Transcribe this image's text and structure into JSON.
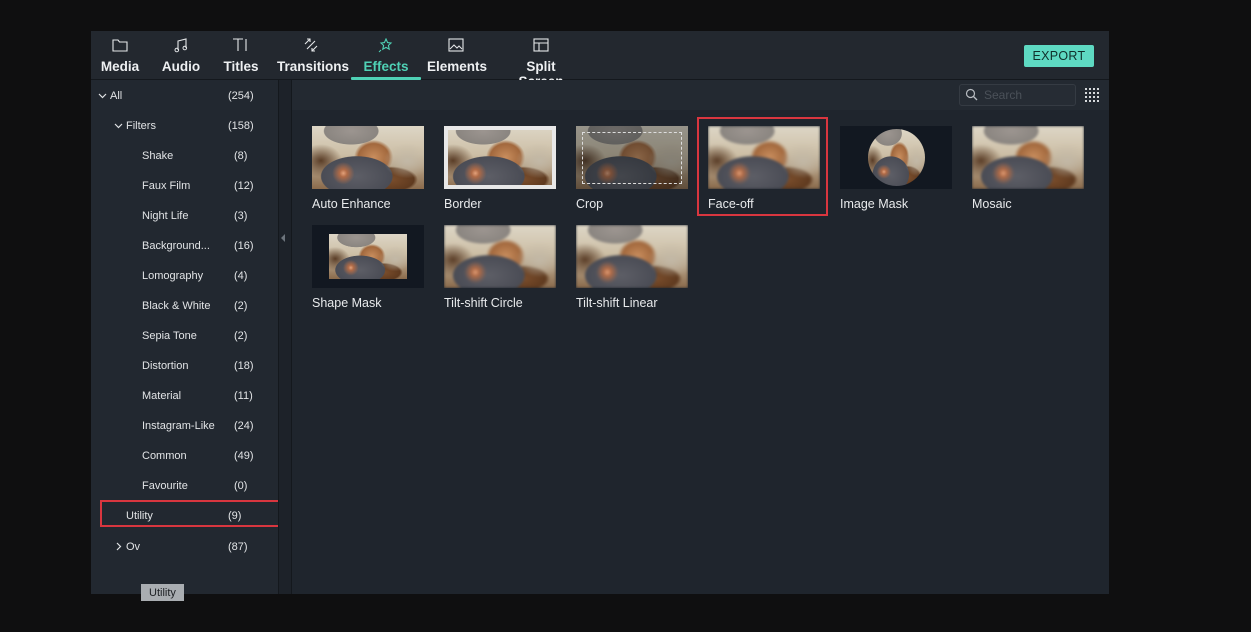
{
  "toolbar": {
    "tabs": [
      {
        "label": "Media",
        "icon": "folder-icon"
      },
      {
        "label": "Audio",
        "icon": "music-note-icon"
      },
      {
        "label": "Titles",
        "icon": "text-cursor-icon"
      },
      {
        "label": "Transitions",
        "icon": "transition-arrows-icon"
      },
      {
        "label": "Effects",
        "icon": "sparkle-icon",
        "active": true
      },
      {
        "label": "Elements",
        "icon": "image-icon"
      },
      {
        "label": "Split Screen",
        "icon": "layout-icon"
      }
    ],
    "export_label": "EXPORT"
  },
  "sidebar": {
    "items": [
      {
        "label": "All",
        "count": "(254)",
        "expanded": true,
        "level": 0
      },
      {
        "label": "Filters",
        "count": "(158)",
        "expanded": true,
        "level": 1
      },
      {
        "label": "Shake",
        "count": "(8)",
        "level": 2
      },
      {
        "label": "Faux Film",
        "count": "(12)",
        "level": 2
      },
      {
        "label": "Night Life",
        "count": "(3)",
        "level": 2
      },
      {
        "label": "Background...",
        "count": "(16)",
        "level": 2
      },
      {
        "label": "Lomography",
        "count": "(4)",
        "level": 2
      },
      {
        "label": "Black & White",
        "count": "(2)",
        "level": 2
      },
      {
        "label": "Sepia Tone",
        "count": "(2)",
        "level": 2
      },
      {
        "label": "Distortion",
        "count": "(18)",
        "level": 2
      },
      {
        "label": "Material",
        "count": "(11)",
        "level": 2
      },
      {
        "label": "Instagram-Like",
        "count": "(24)",
        "level": 2
      },
      {
        "label": "Common",
        "count": "(49)",
        "level": 2
      },
      {
        "label": "Favourite",
        "count": "(0)",
        "level": 2
      },
      {
        "label": "Utility",
        "count": "(9)",
        "level": 1,
        "highlighted": true
      },
      {
        "label": "Ov",
        "count": "(87)",
        "level": 1,
        "collapsed": true
      }
    ],
    "tooltip": "Utility"
  },
  "content": {
    "search_placeholder": "Search",
    "effects": [
      {
        "label": "Auto Enhance"
      },
      {
        "label": "Border"
      },
      {
        "label": "Crop"
      },
      {
        "label": "Face-off",
        "highlighted": true
      },
      {
        "label": "Image Mask"
      },
      {
        "label": "Mosaic"
      },
      {
        "label": "Shape Mask"
      },
      {
        "label": "Tilt-shift Circle"
      },
      {
        "label": "Tilt-shift Linear"
      }
    ]
  },
  "colors": {
    "accent": "#4fd1b5",
    "export_bg": "#5ed9c2",
    "highlight_border": "#d9363f"
  }
}
